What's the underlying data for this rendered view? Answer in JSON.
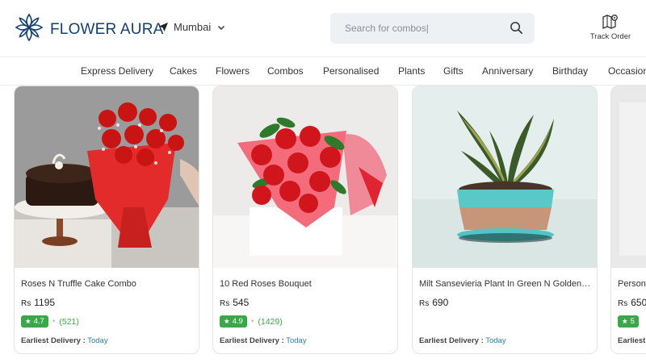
{
  "brand": {
    "name": "FLOWER AURA"
  },
  "location": {
    "city": "Mumbai"
  },
  "search": {
    "placeholder": "Search for combos|"
  },
  "track_order": {
    "label": "Track Order"
  },
  "categories": [
    "Express Delivery",
    "Cakes",
    "Flowers",
    "Combos",
    "Personalised",
    "Plants",
    "Gifts",
    "Anniversary",
    "Birthday",
    "Occasions"
  ],
  "products": [
    {
      "name": "Roses N Truffle Cake Combo",
      "currency": "Rs",
      "price": "1195",
      "rating": "4.7",
      "reviews": "(521)",
      "delivery_label": "Earliest Delivery :",
      "delivery_value": "Today"
    },
    {
      "name": "10 Red Roses Bouquet",
      "currency": "Rs",
      "price": "545",
      "rating": "4.9",
      "reviews": "(1429)",
      "delivery_label": "Earliest Delivery :",
      "delivery_value": "Today"
    },
    {
      "name": "Milt Sansevieria Plant In Green N Golden Pot",
      "currency": "Rs",
      "price": "690",
      "rating": "",
      "reviews": "",
      "delivery_label": "Earliest Delivery :",
      "delivery_value": "Today"
    },
    {
      "name": "Personalised",
      "currency": "Rs",
      "price": "650",
      "rating": "5",
      "reviews": "",
      "delivery_label": "Earliest",
      "delivery_value": ""
    }
  ],
  "colors": {
    "brand_blue": "#16406b",
    "rating_green": "#3aa848",
    "link_blue": "#2a7fa8",
    "search_bg": "#eef1f4"
  }
}
